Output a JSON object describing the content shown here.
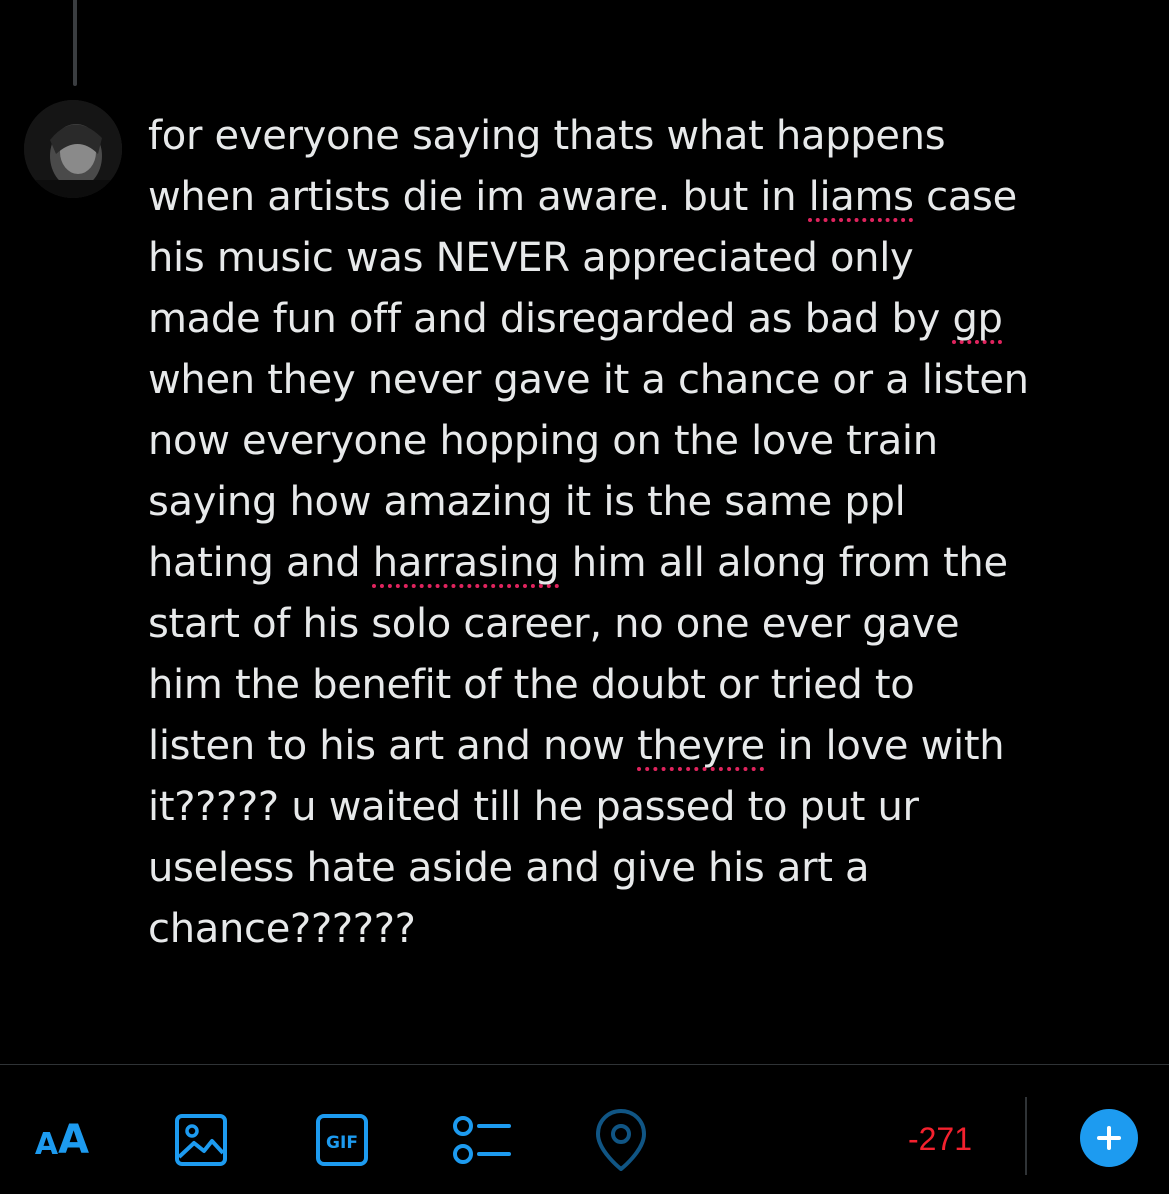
{
  "compose": {
    "segments": [
      {
        "text": "for everyone saying thats what happens\nwhen artists die im aware. but in "
      },
      {
        "text": "liams",
        "misspelled": true
      },
      {
        "text": " case\nhis music was NEVER appreciated only\nmade fun off and disregarded as bad by "
      },
      {
        "text": "gp",
        "misspelled": true
      },
      {
        "text": "\nwhen they never gave it a chance or a listen\nnow everyone hopping on the love train\nsaying how amazing it is the same ppl\nhating and "
      },
      {
        "text": "harrasing",
        "misspelled": true
      },
      {
        "text": " him all along from the\nstart of his solo career, no one ever gave\nhim the benefit of the doubt or tried to\nlisten to his art and now "
      },
      {
        "text": "theyre",
        "misspelled": true
      },
      {
        "text": " in love with\nit????? u waited till he passed to put ur\nuseless hate aside and give his art a\nchance??????"
      }
    ]
  },
  "toolbar": {
    "text_size_label_small": "A",
    "text_size_label_large": "A",
    "char_counter": "-271",
    "icons": [
      "text-size-icon",
      "image-icon",
      "gif-icon",
      "poll-icon",
      "location-icon",
      "plus-icon"
    ]
  },
  "colors": {
    "background": "#000000",
    "text": "#e7e9ea",
    "accent": "#1d9bf0",
    "error": "#f4212e",
    "spellcheck": "#e0245e"
  }
}
